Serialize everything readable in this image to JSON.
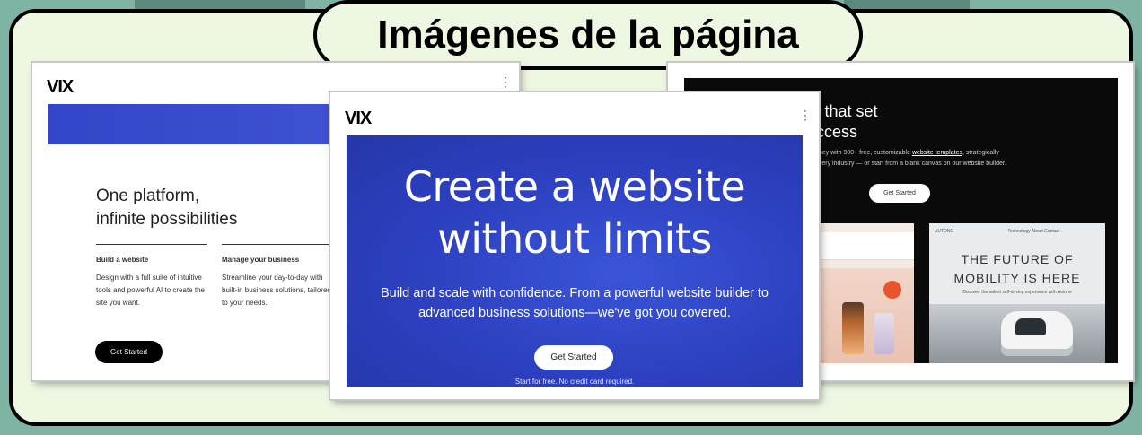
{
  "page_title": "Imágenes de la página",
  "colors": {
    "background": "#7fb3a3",
    "panel": "#eef7e2",
    "wix_blue": "#3346c9"
  },
  "screenshots": {
    "left": {
      "logo": "VIX",
      "headline_line1": "One platform,",
      "headline_line2": "infinite possibilities",
      "col1_title": "Build a website",
      "col1_body": "Design with a full suite of intuitive tools and powerful AI to create the site you want.",
      "col2_title": "Manage your business",
      "col2_body": "Streamline your day-to-day with built-in business solutions, tailored to your needs.",
      "button": "Get Started"
    },
    "center": {
      "logo": "VIX",
      "headline_line1": "Create a website",
      "headline_line2": "without limits",
      "body_line1": "Build and scale with confidence. From a powerful website builder to",
      "body_line2": "advanced business solutions—we've got you covered.",
      "button": "Get Started",
      "fine_print": "Start for free. No credit card required."
    },
    "right": {
      "headline_line1": "ebsite templates that set",
      "headline_line2": "you up for success",
      "sub_pre": "ur journey with 900+ free, customizable ",
      "sub_link": "website templates",
      "sub_post": ", strategically",
      "sub_line2": "d for every industry — or start from a blank canvas on our website builder.",
      "button": "Get Started",
      "template_b_brand": "AUTONO",
      "template_b_nav": "Technology   About   Contact",
      "template_b_line1": "THE FUTURE OF",
      "template_b_line2": "MOBILITY IS HERE",
      "template_b_small": "Discover the safest self-driving experience with Autono"
    }
  }
}
